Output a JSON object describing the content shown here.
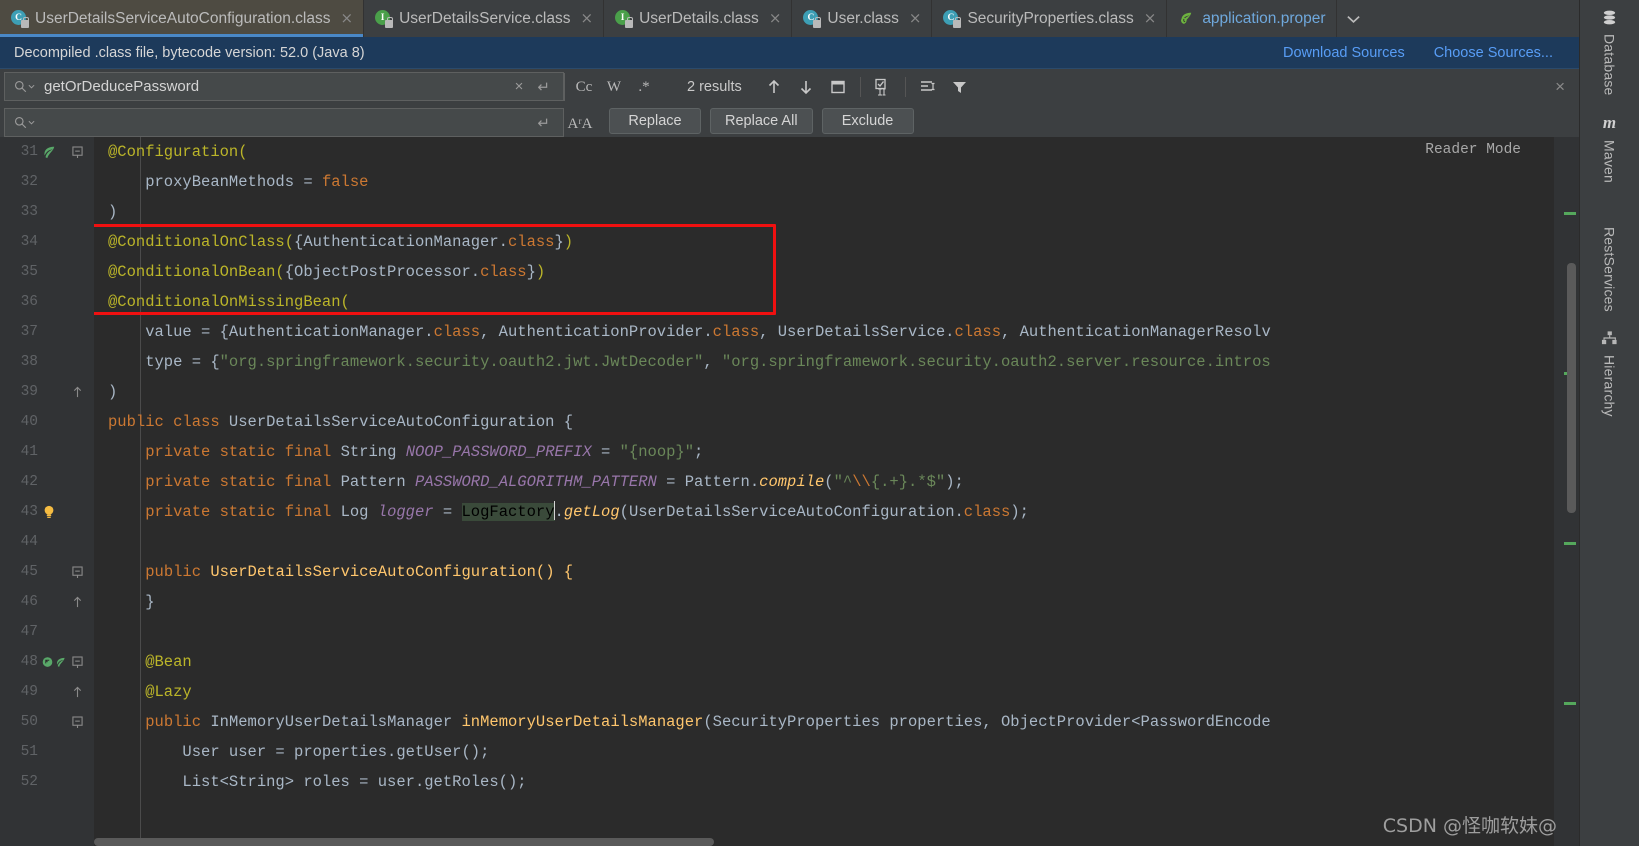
{
  "tabs": [
    {
      "label": "UserDetailsServiceAutoConfiguration.class",
      "icon": "class-icon",
      "active": true,
      "close": "×"
    },
    {
      "label": "UserDetailsService.class",
      "icon": "interface-icon",
      "active": false,
      "close": "×"
    },
    {
      "label": "UserDetails.class",
      "icon": "interface-icon",
      "active": false,
      "close": "×"
    },
    {
      "label": "User.class",
      "icon": "class-icon",
      "active": false,
      "close": "×"
    },
    {
      "label": "SecurityProperties.class",
      "icon": "class-icon",
      "active": false,
      "close": "×"
    },
    {
      "label": "application.proper",
      "icon": "spring-leaf-icon",
      "active": false,
      "close": ""
    }
  ],
  "tab_overflow_chevron": "⌄",
  "notification": {
    "text": "Decompiled .class file, bytecode version: 52.0 (Java 8)",
    "download_sources": "Download Sources",
    "choose_sources": "Choose Sources..."
  },
  "find": {
    "search_value": "getOrDeducePassword",
    "replace_value": "",
    "replace_placeholder": "",
    "clear_icon": "×",
    "history_icon": "↵",
    "match_case": "Cc",
    "words": "W",
    "regex": ".*",
    "results_text": "2 results",
    "prev_icon": "↑",
    "next_icon": "↓",
    "select_all_icon": "select-all-occurrences",
    "in_selection_icon": "in-selection",
    "preserve_case_icon": "preserve-case",
    "filter_icon": "filter",
    "close_icon": "×",
    "preserve_case_label": "AʳA",
    "buttons": {
      "replace": "Replace",
      "replace_all": "Replace All",
      "exclude": "Exclude"
    }
  },
  "editor": {
    "reader_mode": "Reader Mode",
    "first_line": 31,
    "lines": [
      {
        "n": 31,
        "fold": "minus",
        "marks": [
          "spring-bean-icon"
        ],
        "tokens": [
          {
            "t": "@Configuration(",
            "c": "ann"
          }
        ]
      },
      {
        "n": 32,
        "fold": "",
        "marks": [],
        "tokens": [
          {
            "t": "    proxyBeanMethods = ",
            "c": "plain"
          },
          {
            "t": "false",
            "c": "kw"
          }
        ]
      },
      {
        "n": 33,
        "fold": "",
        "marks": [],
        "tokens": [
          {
            "t": ")",
            "c": "plain"
          }
        ]
      },
      {
        "n": 34,
        "fold": "",
        "marks": [],
        "tokens": [
          {
            "t": "@ConditionalOnClass(",
            "c": "ann"
          },
          {
            "t": "{AuthenticationManager.",
            "c": "plain"
          },
          {
            "t": "class",
            "c": "kw"
          },
          {
            "t": "}",
            "c": "plain"
          },
          {
            "t": ")",
            "c": "ann"
          }
        ]
      },
      {
        "n": 35,
        "fold": "",
        "marks": [],
        "tokens": [
          {
            "t": "@ConditionalOnBean(",
            "c": "ann"
          },
          {
            "t": "{ObjectPostProcessor.",
            "c": "plain"
          },
          {
            "t": "class",
            "c": "kw"
          },
          {
            "t": "}",
            "c": "plain"
          },
          {
            "t": ")",
            "c": "ann"
          }
        ]
      },
      {
        "n": 36,
        "fold": "",
        "marks": [],
        "tokens": [
          {
            "t": "@ConditionalOnMissingBean(",
            "c": "ann"
          }
        ]
      },
      {
        "n": 37,
        "fold": "",
        "marks": [],
        "tokens": [
          {
            "t": "    value = {AuthenticationManager.",
            "c": "plain"
          },
          {
            "t": "class",
            "c": "kw"
          },
          {
            "t": ", AuthenticationProvider.",
            "c": "plain"
          },
          {
            "t": "class",
            "c": "kw"
          },
          {
            "t": ", UserDetailsService.",
            "c": "plain"
          },
          {
            "t": "class",
            "c": "kw"
          },
          {
            "t": ", AuthenticationManagerResolv",
            "c": "plain"
          }
        ]
      },
      {
        "n": 38,
        "fold": "",
        "marks": [],
        "tokens": [
          {
            "t": "    type = {",
            "c": "plain"
          },
          {
            "t": "\"org.springframework.security.oauth2.jwt.JwtDecoder\"",
            "c": "str"
          },
          {
            "t": ", ",
            "c": "plain"
          },
          {
            "t": "\"org.springframework.security.oauth2.server.resource.intros",
            "c": "str"
          }
        ]
      },
      {
        "n": 39,
        "fold": "end",
        "marks": [],
        "tokens": [
          {
            "t": ")",
            "c": "plain"
          }
        ]
      },
      {
        "n": 40,
        "fold": "",
        "marks": [],
        "tokens": [
          {
            "t": "public class ",
            "c": "kw"
          },
          {
            "t": "UserDetailsServiceAutoConfiguration {",
            "c": "plain"
          }
        ]
      },
      {
        "n": 41,
        "fold": "",
        "marks": [],
        "tokens": [
          {
            "t": "    ",
            "c": "plain"
          },
          {
            "t": "private static final ",
            "c": "kw"
          },
          {
            "t": "String ",
            "c": "plain"
          },
          {
            "t": "NOOP_PASSWORD_PREFIX",
            "c": "fld"
          },
          {
            "t": " = ",
            "c": "plain"
          },
          {
            "t": "\"{noop}\"",
            "c": "str"
          },
          {
            "t": ";",
            "c": "plain"
          }
        ]
      },
      {
        "n": 42,
        "fold": "",
        "marks": [],
        "tokens": [
          {
            "t": "    ",
            "c": "plain"
          },
          {
            "t": "private static final ",
            "c": "kw"
          },
          {
            "t": "Pattern ",
            "c": "plain"
          },
          {
            "t": "PASSWORD_ALGORITHM_PATTERN",
            "c": "fld"
          },
          {
            "t": " = Pattern.",
            "c": "plain"
          },
          {
            "t": "compile",
            "c": "mth-italic"
          },
          {
            "t": "(",
            "c": "plain"
          },
          {
            "t": "\"^",
            "c": "str"
          },
          {
            "t": "\\\\",
            "c": "esc"
          },
          {
            "t": "{.+}.*$\"",
            "c": "str"
          },
          {
            "t": ");",
            "c": "plain"
          }
        ]
      },
      {
        "n": 43,
        "fold": "",
        "marks": [
          "intention-bulb-icon"
        ],
        "tokens": [
          {
            "t": "    ",
            "c": "plain"
          },
          {
            "t": "private static final ",
            "c": "kw"
          },
          {
            "t": "Log ",
            "c": "plain"
          },
          {
            "t": "logger",
            "c": "fld"
          },
          {
            "t": " = ",
            "c": "plain"
          },
          {
            "t": "LogFactory",
            "c": "sel"
          },
          {
            "t": "CARET",
            "c": "caret"
          },
          {
            "t": ".",
            "c": "plain"
          },
          {
            "t": "getLog",
            "c": "mth-italic"
          },
          {
            "t": "(UserDetailsServiceAutoConfiguration.",
            "c": "plain"
          },
          {
            "t": "class",
            "c": "kw"
          },
          {
            "t": ");",
            "c": "plain"
          }
        ]
      },
      {
        "n": 44,
        "fold": "",
        "marks": [],
        "tokens": []
      },
      {
        "n": 45,
        "fold": "minus",
        "marks": [],
        "tokens": [
          {
            "t": "    ",
            "c": "plain"
          },
          {
            "t": "public ",
            "c": "kw"
          },
          {
            "t": "UserDetailsServiceAutoConfiguration() {",
            "c": "mth"
          }
        ]
      },
      {
        "n": 46,
        "fold": "end",
        "marks": [],
        "tokens": [
          {
            "t": "    }",
            "c": "plain"
          }
        ]
      },
      {
        "n": 47,
        "fold": "",
        "marks": [],
        "tokens": []
      },
      {
        "n": 48,
        "fold": "minus",
        "marks": [
          "override-icon",
          "spring-bean-icon"
        ],
        "tokens": [
          {
            "t": "    @Bean",
            "c": "ann"
          }
        ]
      },
      {
        "n": 49,
        "fold": "end",
        "marks": [],
        "tokens": [
          {
            "t": "    @Lazy",
            "c": "ann"
          }
        ]
      },
      {
        "n": 50,
        "fold": "minus",
        "marks": [],
        "tokens": [
          {
            "t": "    ",
            "c": "plain"
          },
          {
            "t": "public ",
            "c": "kw"
          },
          {
            "t": "InMemoryUserDetailsManager ",
            "c": "plain"
          },
          {
            "t": "inMemoryUserDetailsManager",
            "c": "mth"
          },
          {
            "t": "(SecurityProperties properties, ObjectProvider<PasswordEncode",
            "c": "plain"
          }
        ]
      },
      {
        "n": 51,
        "fold": "",
        "marks": [],
        "tokens": [
          {
            "t": "        User user = properties.",
            "c": "plain"
          },
          {
            "t": "getUser",
            "c": "plain"
          },
          {
            "t": "();",
            "c": "plain"
          }
        ]
      },
      {
        "n": 52,
        "fold": "",
        "marks": [],
        "tokens": [
          {
            "t": "        List<String> roles = user.getRoles();",
            "c": "plain"
          }
        ]
      }
    ]
  },
  "right_sidebar": [
    {
      "label": "Database",
      "icon": "database-icon"
    },
    {
      "label": "Maven",
      "icon": "maven-m-icon"
    },
    {
      "label": "RestServices",
      "icon": ""
    },
    {
      "label": "Hierarchy",
      "icon": "hierarchy-icon"
    }
  ],
  "watermark": "CSDN @怪咖软妹@",
  "colors": {
    "accent_blue": "#4a88c7",
    "link_blue": "#589df6",
    "notification_bg": "#1d3a5b",
    "highlight_red": "#f01010",
    "annotation_yellow": "#bbb529",
    "keyword_orange": "#cc7832",
    "string_green": "#6a8759",
    "editor_bg": "#2b2b2b",
    "panel_bg": "#3c3f41"
  }
}
